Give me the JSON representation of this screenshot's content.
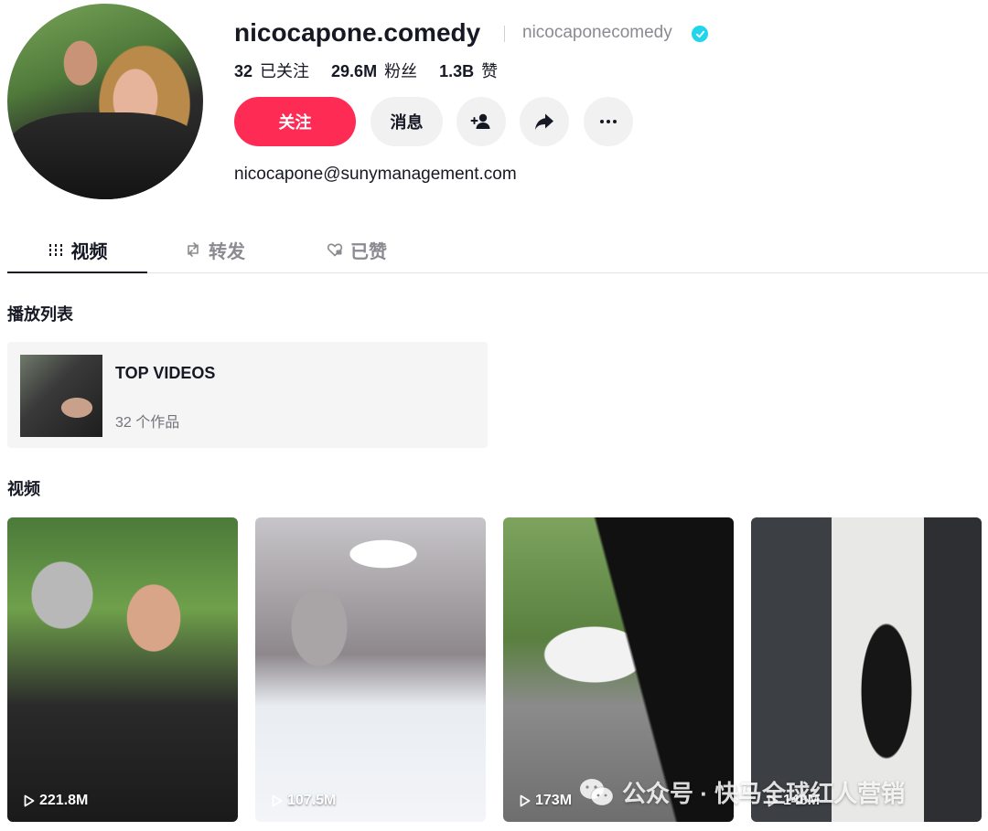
{
  "profile": {
    "username": "nicocapone.comedy",
    "nickname": "nicocaponecomedy",
    "verified": true,
    "bio_link": "nicocapone@sunymanagement.com",
    "stats": [
      {
        "value": "32",
        "label": "已关注"
      },
      {
        "value": "29.6M",
        "label": "粉丝"
      },
      {
        "value": "1.3B",
        "label": "赞"
      }
    ]
  },
  "actions": {
    "follow": "关注",
    "message": "消息"
  },
  "tabs": [
    {
      "label": "视频",
      "icon": "grid-icon",
      "active": true
    },
    {
      "label": "转发",
      "icon": "repost-icon",
      "active": false
    },
    {
      "label": "已赞",
      "icon": "heart-icon",
      "active": false
    }
  ],
  "playlists": {
    "section_title": "播放列表",
    "items": [
      {
        "name": "TOP VIDEOS",
        "count": "32 个作品"
      }
    ]
  },
  "videos": {
    "section_title": "视频",
    "items": [
      {
        "views": "221.8M"
      },
      {
        "views": "107.5M"
      },
      {
        "views": "173M"
      },
      {
        "views": "148M"
      }
    ]
  },
  "watermark": {
    "text": "公众号 · 快马全球红人营销"
  },
  "colors": {
    "accent": "#fe2c55",
    "verified": "#20d5ec",
    "button_bg": "#f1f1f2",
    "muted_text": "#8a8b91"
  }
}
